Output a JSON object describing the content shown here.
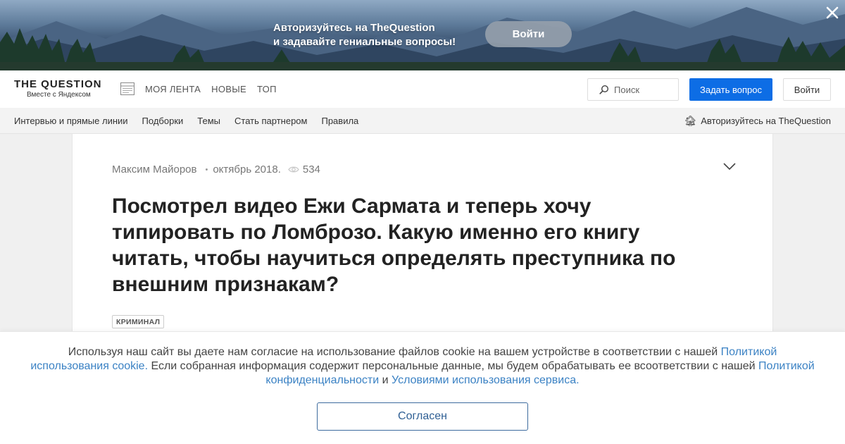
{
  "banner": {
    "line1": "Авторизуйтесь на TheQuestion",
    "line2": "и задавайте гениальные вопросы!",
    "button": "Войти"
  },
  "header": {
    "logo_title": "THE QUESTION",
    "logo_subtitle": "Вместе с Яндексом",
    "nav": [
      "МОЯ ЛЕНТА",
      "НОВЫЕ",
      "ТОП"
    ],
    "search_placeholder": "Поиск",
    "ask_button": "Задать вопрос",
    "login_button": "Войти",
    "accent_color": "#0d6de5"
  },
  "subnav": {
    "items": [
      "Интервью и прямые линии",
      "Подборки",
      "Темы",
      "Стать партнером",
      "Правила"
    ],
    "auth_emoji": "🏚",
    "auth_text": "Авторизуйтесь на TheQuestion"
  },
  "question": {
    "author": "Максим Майоров",
    "date": "октябрь 2018.",
    "views": "534",
    "title": "Посмотрел видео Ежи Сармата и теперь хочу типировать по Ломброзо. Какую именно его книгу читать, чтобы научиться определять преступника по внешним признакам?",
    "tag": "КРИМИНАЛ"
  },
  "cookie": {
    "text1": "Используя наш сайт вы даете нам согласие на использование файлов cookie на вашем устройстве в соответствии с нашей ",
    "link1": "Политикой использования cookie.",
    "text2": " Если собранная информация содержит персональные данные, мы будем обрабатывать ее всоответствии с нашей ",
    "link2": "Политикой конфиденциальности",
    "text3": " и ",
    "link3": "Условиями использования сервиса.",
    "button": "Согласен",
    "link_color": "#3b82c4"
  }
}
